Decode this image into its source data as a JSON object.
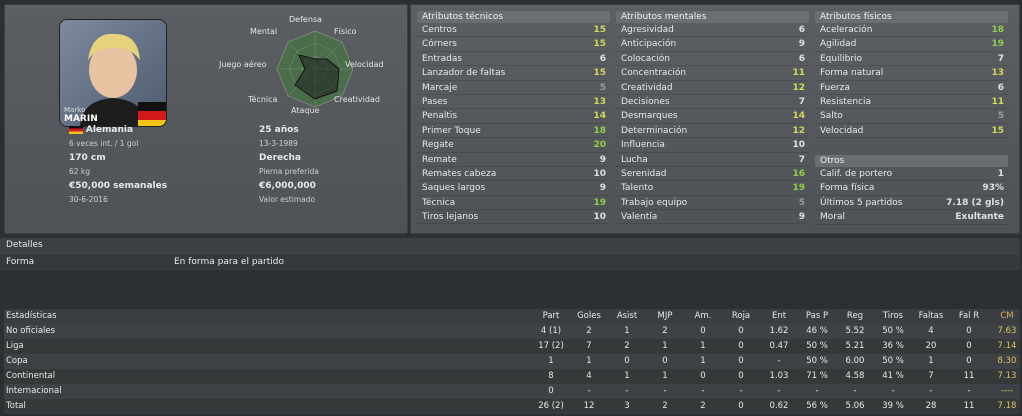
{
  "player": {
    "first_name": "Marko",
    "last_name": "MARIN",
    "nationality": "Alemania",
    "caps": "6 veces int. / 1 gol",
    "age": "25 años",
    "birth_date": "13-3-1989",
    "height": "170 cm",
    "weight": "62 kg",
    "foot": "Derecha",
    "foot_label": "Pierna preferida",
    "wage": "€50,000 semanales",
    "contract_end": "30-6-2016",
    "value": "€6,000,000",
    "value_label": "Valor estimado"
  },
  "radar": {
    "labels": [
      "Defensa",
      "Físico",
      "Velocidad",
      "Creatividad",
      "Ataque",
      "Técnica",
      "Juego aéreo",
      "Mental"
    ]
  },
  "technical": {
    "header": "Atributos técnicos",
    "rows": [
      {
        "name": "Centros",
        "value": "15",
        "color": "y"
      },
      {
        "name": "Córners",
        "value": "15",
        "color": "y"
      },
      {
        "name": "Entradas",
        "value": "6",
        "color": "w"
      },
      {
        "name": "Lanzador de faltas",
        "value": "15",
        "color": "y"
      },
      {
        "name": "Marcaje",
        "value": "5",
        "color": "d"
      },
      {
        "name": "Pases",
        "value": "13",
        "color": "y"
      },
      {
        "name": "Penaltis",
        "value": "14",
        "color": "y"
      },
      {
        "name": "Primer Toque",
        "value": "18",
        "color": "g"
      },
      {
        "name": "Regate",
        "value": "20",
        "color": "g"
      },
      {
        "name": "Remate",
        "value": "9",
        "color": "w"
      },
      {
        "name": "Remates cabeza",
        "value": "10",
        "color": "w"
      },
      {
        "name": "Saques largos",
        "value": "9",
        "color": "w"
      },
      {
        "name": "Técnica",
        "value": "19",
        "color": "g"
      },
      {
        "name": "Tiros lejanos",
        "value": "10",
        "color": "w"
      }
    ]
  },
  "mental": {
    "header": "Atributos mentales",
    "rows": [
      {
        "name": "Agresividad",
        "value": "6",
        "color": "w"
      },
      {
        "name": "Anticipación",
        "value": "9",
        "color": "w"
      },
      {
        "name": "Colocación",
        "value": "6",
        "color": "w"
      },
      {
        "name": "Concentración",
        "value": "11",
        "color": "y"
      },
      {
        "name": "Creatividad",
        "value": "12",
        "color": "y"
      },
      {
        "name": "Decisiones",
        "value": "7",
        "color": "w"
      },
      {
        "name": "Desmarques",
        "value": "14",
        "color": "y"
      },
      {
        "name": "Determinación",
        "value": "12",
        "color": "y"
      },
      {
        "name": "Influencia",
        "value": "10",
        "color": "w"
      },
      {
        "name": "Lucha",
        "value": "7",
        "color": "w"
      },
      {
        "name": "Serenidad",
        "value": "16",
        "color": "g"
      },
      {
        "name": "Talento",
        "value": "19",
        "color": "g"
      },
      {
        "name": "Trabajo equipo",
        "value": "5",
        "color": "d"
      },
      {
        "name": "Valentía",
        "value": "9",
        "color": "w"
      }
    ]
  },
  "physical": {
    "header": "Atributos físicos",
    "rows": [
      {
        "name": "Aceleración",
        "value": "18",
        "color": "g"
      },
      {
        "name": "Agilidad",
        "value": "19",
        "color": "g"
      },
      {
        "name": "Equilibrio",
        "value": "7",
        "color": "w"
      },
      {
        "name": "Forma natural",
        "value": "13",
        "color": "y"
      },
      {
        "name": "Fuerza",
        "value": "6",
        "color": "w"
      },
      {
        "name": "Resistencia",
        "value": "11",
        "color": "y"
      },
      {
        "name": "Salto",
        "value": "5",
        "color": "d"
      },
      {
        "name": "Velocidad",
        "value": "15",
        "color": "y"
      }
    ]
  },
  "others": {
    "header": "Otros",
    "rows": [
      {
        "name": "Calif. de portero",
        "value": "1"
      },
      {
        "name": "Forma física",
        "value": "93%"
      },
      {
        "name": "Últimos 5 partidos",
        "value": "7.18 (2 gls)"
      },
      {
        "name": "Moral",
        "value": "Exultante"
      }
    ]
  },
  "details": {
    "header": "Detalles",
    "label": "Forma",
    "value": "En forma para el partido"
  },
  "stats": {
    "header": "Estadísticas",
    "columns": [
      "Part",
      "Goles",
      "Asist",
      "MJP",
      "Am.",
      "Roja",
      "Ent",
      "Pas P",
      "Reg",
      "Tiros",
      "Faltas",
      "Fal R",
      "CM"
    ],
    "rows": [
      {
        "name": "No oficiales",
        "cells": [
          "4 (1)",
          "2",
          "1",
          "2",
          "0",
          "0",
          "1.62",
          "46 %",
          "5.52",
          "50 %",
          "4",
          "0",
          "7.63"
        ]
      },
      {
        "name": "Liga",
        "cells": [
          "17 (2)",
          "7",
          "2",
          "1",
          "1",
          "0",
          "0.47",
          "50 %",
          "5.21",
          "36 %",
          "20",
          "0",
          "7.14"
        ]
      },
      {
        "name": "Copa",
        "cells": [
          "1",
          "1",
          "0",
          "0",
          "1",
          "0",
          "-",
          "50 %",
          "6.00",
          "50 %",
          "1",
          "0",
          "8.30"
        ]
      },
      {
        "name": "Continental",
        "cells": [
          "8",
          "4",
          "1",
          "1",
          "0",
          "0",
          "1.03",
          "71 %",
          "4.58",
          "41 %",
          "7",
          "11",
          "7.13"
        ]
      },
      {
        "name": "Internacional",
        "cells": [
          "0",
          "-",
          "-",
          "-",
          "-",
          "-",
          "-",
          "-",
          "-",
          "-",
          "-",
          "-",
          "----"
        ]
      },
      {
        "name": "Total",
        "cells": [
          "26 (2)",
          "12",
          "3",
          "2",
          "2",
          "0",
          "0.62",
          "56 %",
          "5.06",
          "39 %",
          "28",
          "11",
          "7.18"
        ]
      }
    ]
  }
}
